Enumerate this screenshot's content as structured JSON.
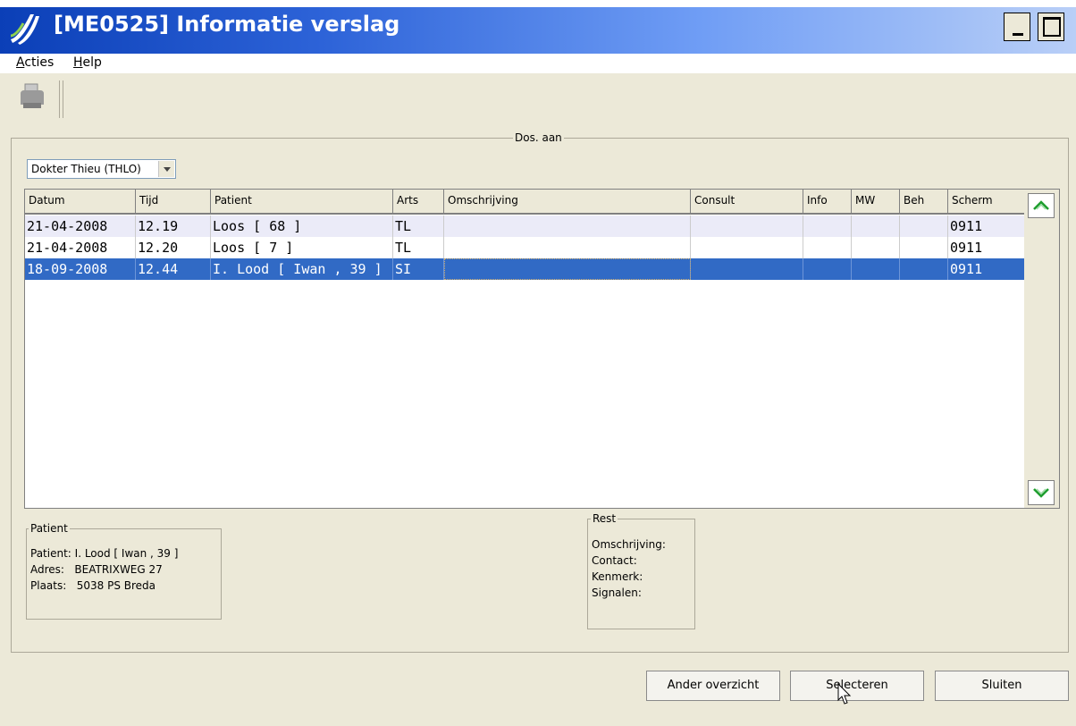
{
  "window": {
    "title": "[ME0525] Informatie verslag"
  },
  "menu": {
    "acties": {
      "accel": "A",
      "rest": "cties"
    },
    "help": {
      "accel": "H",
      "rest": "elp"
    }
  },
  "toolbar": {
    "print_icon": "printer-icon"
  },
  "group": {
    "legend": "Dos. aan"
  },
  "filter": {
    "selected": "Dokter Thieu (THLO)"
  },
  "table": {
    "columns": [
      "Datum",
      "Tijd",
      "Patient",
      "Arts",
      "Omschrijving",
      "Consult",
      "Info",
      "MW",
      "Beh",
      "Scherm"
    ],
    "rows": [
      [
        "21-04-2008",
        "12.19",
        "Loos [ 68 ]",
        "TL",
        "",
        "",
        "",
        "",
        "",
        "0911"
      ],
      [
        "21-04-2008",
        "12.20",
        "Loos [ 7 ]",
        "TL",
        "",
        "",
        "",
        "",
        "",
        "0911"
      ],
      [
        "18-09-2008",
        "12.44",
        "I. Lood [ Iwan , 39 ]",
        "SI",
        "",
        "",
        "",
        "",
        "",
        "0911"
      ]
    ],
    "selected_row": 3
  },
  "patient_pane": {
    "legend": "Patient",
    "patient_label": "Patient:",
    "patient_value": "I. Lood [ Iwan , 39 ]",
    "adres_label": "Adres:",
    "adres_value": "BEATRIXWEG 27",
    "plaats_label": "Plaats:",
    "plaats_value": "5038 PS Breda"
  },
  "rest_pane": {
    "legend": "Rest",
    "omschrijving": "Omschrijving:",
    "contact": "Contact:",
    "kenmerk": "Kenmerk:",
    "signalen": "Signalen:"
  },
  "buttons": {
    "ander_overzicht": "Ander overzicht",
    "selecteren": "Selecteren",
    "sluiten": "Sluiten"
  },
  "colors": {
    "selection": "#316ac5",
    "titlebar": "#0b3fb7",
    "scroll_arrow": "#1e9e2e"
  }
}
